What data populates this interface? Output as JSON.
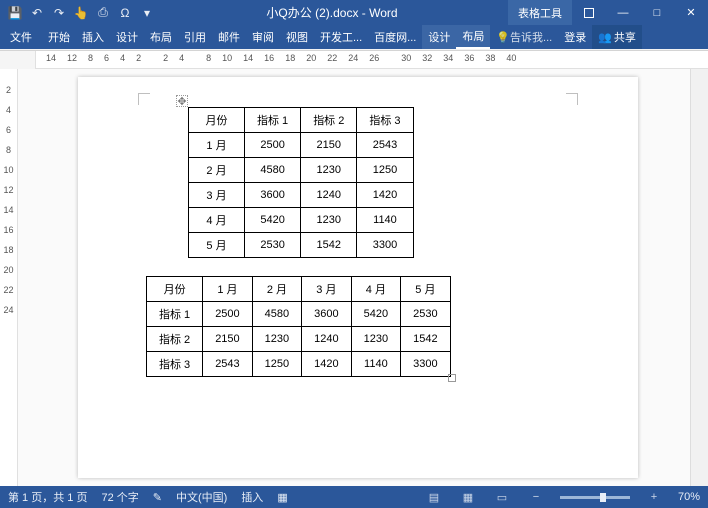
{
  "title": "小Q办公 (2).docx - Word",
  "contextual_tab": "表格工具",
  "qat": {
    "save": "💾",
    "undo": "↶",
    "redo": "↷",
    "touch": "👆",
    "print": "⎙",
    "user": "Ω"
  },
  "wincontrols": {
    "ribbonopt": "▭",
    "min": "—",
    "max": "□",
    "close": "✕"
  },
  "tabs": {
    "file": "文件",
    "home": "开始",
    "insert": "插入",
    "design": "设计",
    "layout": "布局",
    "references": "引用",
    "mailings": "邮件",
    "review": "审阅",
    "view": "视图",
    "dev": "开发工...",
    "baidu": "百度网...",
    "tdesign": "设计",
    "tlayout": "布局",
    "tell": "告诉我...",
    "login": "登录",
    "share": "共享"
  },
  "hruler": [
    "14",
    "12",
    "8",
    "6",
    "4",
    "2",
    "",
    "2",
    "4",
    "",
    "8",
    "10",
    "14",
    "16",
    "18",
    "20",
    "22",
    "24",
    "26",
    "",
    "30",
    "32",
    "34",
    "36",
    "38",
    "40"
  ],
  "vruler": [
    "",
    "2",
    "4",
    "6",
    "8",
    "10",
    "12",
    "14",
    "16",
    "18",
    "20",
    "22",
    "24"
  ],
  "table1": {
    "headers": [
      "月份",
      "指标 1",
      "指标 2",
      "指标 3"
    ],
    "rows": [
      [
        "1 月",
        "2500",
        "2150",
        "2543"
      ],
      [
        "2 月",
        "4580",
        "1230",
        "1250"
      ],
      [
        "3 月",
        "3600",
        "1240",
        "1420"
      ],
      [
        "4 月",
        "5420",
        "1230",
        "1140"
      ],
      [
        "5 月",
        "2530",
        "1542",
        "3300"
      ]
    ]
  },
  "table2": {
    "headers": [
      "月份",
      "1 月",
      "2 月",
      "3 月",
      "4 月",
      "5 月"
    ],
    "rows": [
      [
        "指标 1",
        "2500",
        "4580",
        "3600",
        "5420",
        "2530"
      ],
      [
        "指标 2",
        "2150",
        "1230",
        "1240",
        "1230",
        "1542"
      ],
      [
        "指标 3",
        "2543",
        "1250",
        "1420",
        "1140",
        "3300"
      ]
    ]
  },
  "status": {
    "page": "第 1 页，共 1 页",
    "words": "72 个字",
    "spell": "✎",
    "lang": "中文(中国)",
    "insert": "插入",
    "macro": "▦"
  },
  "zoom": "70%"
}
